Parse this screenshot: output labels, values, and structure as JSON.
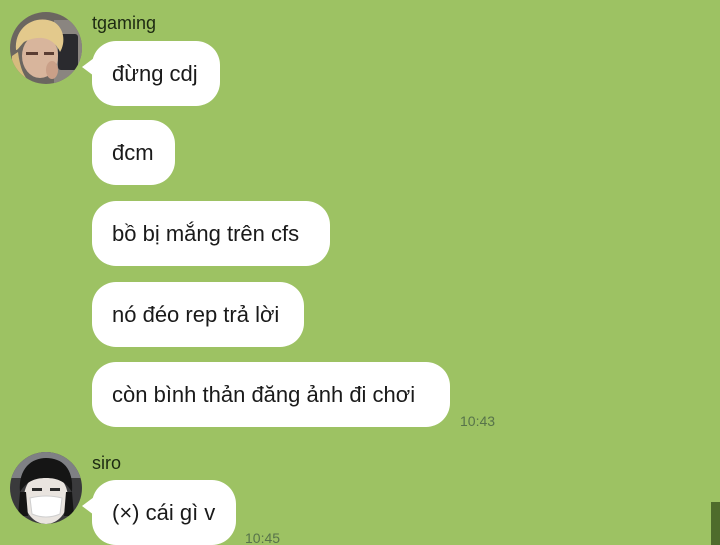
{
  "chat": {
    "background_color": "#9dc263",
    "groups": [
      {
        "sender": "tgaming",
        "avatar_icon": "blond-person-avatar-icon",
        "messages": [
          "đừng cdj",
          "đcm",
          "bồ bị mắng trên cfs",
          "nó đéo rep trả lời",
          "còn bình thản đăng ảnh đi chơi"
        ],
        "timestamp": "10:43"
      },
      {
        "sender": "siro",
        "avatar_icon": "masked-person-avatar-icon",
        "messages": [
          "(×) cái gì v"
        ],
        "timestamp": "10:45"
      }
    ]
  }
}
